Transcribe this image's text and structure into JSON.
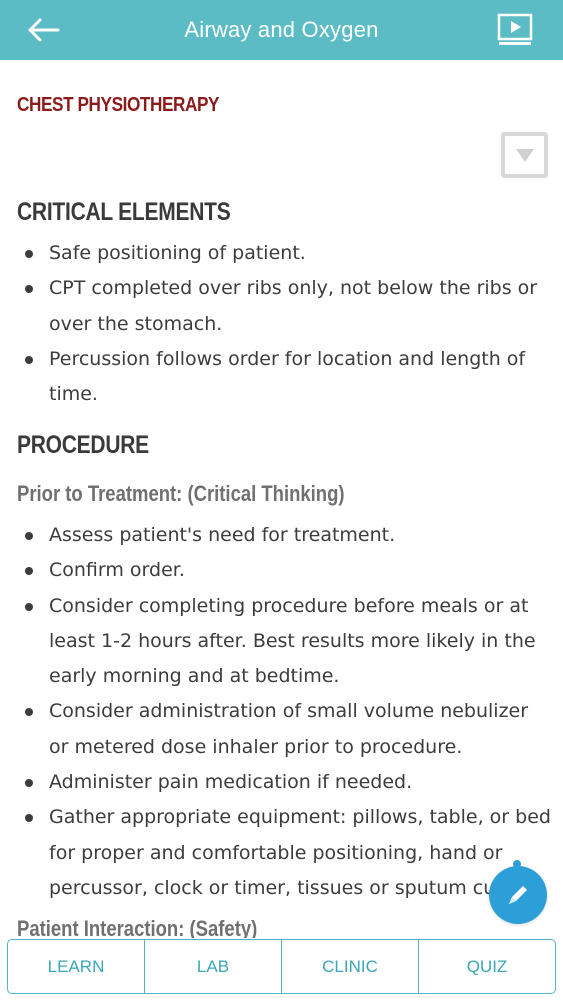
{
  "header": {
    "title": "Airway and Oxygen",
    "back_icon": "back-arrow-icon",
    "video_icon": "video-play-icon"
  },
  "content": {
    "section_title": "CHEST PHYSIOTHERAPY",
    "critical_elements": {
      "heading": "CRITICAL ELEMENTS",
      "items": [
        "Safe positioning of patient.",
        "CPT completed over ribs only, not below the ribs or over the stomach.",
        "Percussion follows order for location and length of time."
      ]
    },
    "procedure": {
      "heading": "PROCEDURE",
      "prior": {
        "heading": "Prior to Treatment: (Critical Thinking)",
        "items": [
          "Assess patient's need for treatment.",
          "Confirm order.",
          "Consider completing procedure before meals or at least 1-2 hours after. Best results more likely in the early morning and at bedtime.",
          "Consider administration of small volume nebulizer or metered dose inhaler prior to procedure.",
          "Administer pain medication if needed.",
          "Gather appropriate equipment: pillows, table, or bed for proper and comfortable positioning, hand or percussor, clock or timer, tissues or sputum cup."
        ]
      },
      "interaction_heading": "Patient Interaction: (Safety)"
    }
  },
  "bottom_nav": {
    "tabs": [
      "LEARN",
      "LAB",
      "CLINIC",
      "QUIZ"
    ]
  },
  "colors": {
    "header_bg": "#5bbcc6",
    "section_title": "#8b1a1a",
    "nav_accent": "#3aa7b6",
    "fab": "#2d9fd8"
  }
}
